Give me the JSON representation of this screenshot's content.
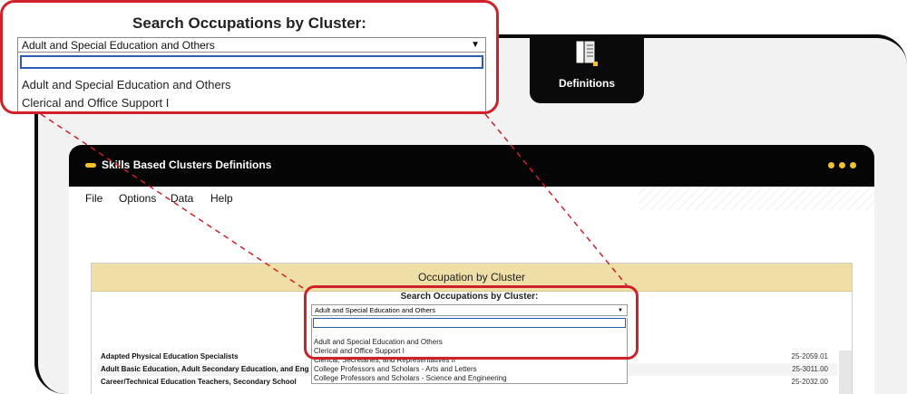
{
  "top_tab": {
    "label": "Definitions",
    "icon": "book-icon"
  },
  "window": {
    "title": "Skills Based Clusters Definitions",
    "menu": [
      "File",
      "Options",
      "Data",
      "Help"
    ],
    "sheet_header": "Occupation by Cluster",
    "rows": [
      {
        "name": "Adapted Physical Education Specialists",
        "code": "25-2059.01"
      },
      {
        "name": "Adult Basic Education, Adult Secondary Education, and Eng",
        "code": "25-3011.00"
      },
      {
        "name": "Career/Technical Education Teachers, Secondary School",
        "code": "25-2032.00"
      }
    ]
  },
  "dropdown": {
    "heading": "Search Occupations by Cluster:",
    "selected": "Adult and Special Education and Others",
    "options": [
      "Adult and Special Education and Others",
      "Clerical and Office Support I",
      "Clerical, Secretaries, and Representatives II",
      "College Professors and Scholars - Arts and Letters",
      "College Professors and Scholars - Science and Engineering"
    ]
  },
  "colors": {
    "accent": "#f2c12e",
    "highlight": "#d0202a",
    "band": "#efdfa6"
  }
}
